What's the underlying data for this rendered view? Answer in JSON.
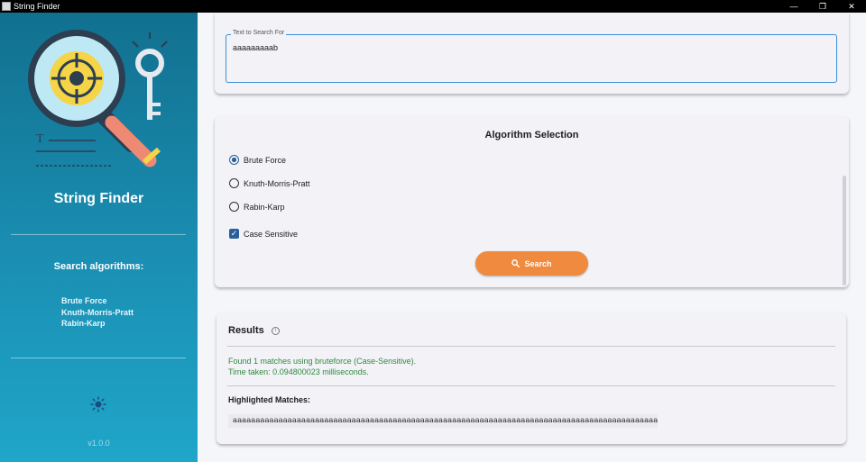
{
  "window": {
    "title": "String Finder",
    "controls": {
      "minimize": "—",
      "maximize": "❐",
      "close": "✕"
    }
  },
  "sidebar": {
    "app_name": "String Finder",
    "algorithms_heading": "Search algorithms:",
    "algorithms": [
      "Brute Force",
      "Knuth-Morris-Pratt",
      "Rabin-Karp"
    ],
    "version": "v1.0.0"
  },
  "search_input": {
    "label": "Text to Search For",
    "value": "aaaaaaaaab"
  },
  "algorithm_selection": {
    "title": "Algorithm Selection",
    "options": [
      {
        "label": "Brute Force",
        "selected": true
      },
      {
        "label": "Knuth-Morris-Pratt",
        "selected": false
      },
      {
        "label": "Rabin-Karp",
        "selected": false
      }
    ],
    "case_sensitive": {
      "label": "Case Sensitive",
      "checked": true
    },
    "search_button": "Search"
  },
  "results": {
    "title": "Results",
    "status_line_1": "Found 1 matches using bruteforce (Case-Sensitive).",
    "status_line_2": "Time taken: 0.094800023 milliseconds.",
    "highlighted_title": "Highlighted Matches:",
    "text_before_match": "aaaaaaaaaaaaaaaaaaaaaaaaaaaaaaaaaaaaaaaaaaaaaaaaaaaaaaaaaaaaaaaaaaaaaaaaaaaaaaaaaaaaaaaaaaaaaaaaaaaa",
    "match": "aaaaaaaaab"
  },
  "colors": {
    "accent": "#ef8a3e",
    "primary": "#2b5f9c",
    "sidebar_top": "#12708f",
    "sidebar_bottom": "#1fa6c9",
    "status_text": "#2e8b3d"
  }
}
